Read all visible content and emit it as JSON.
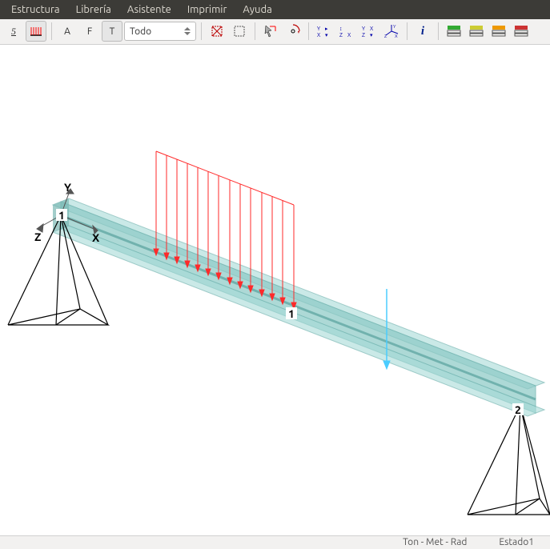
{
  "menu": {
    "items": [
      {
        "label": "Estructura"
      },
      {
        "label": "Librería"
      },
      {
        "label": "Asistente"
      },
      {
        "label": "Imprimir"
      },
      {
        "label": "Ayuda"
      }
    ]
  },
  "toolbar": {
    "node_number": "5",
    "letter_a": "A",
    "letter_f": "F",
    "letter_t": "T",
    "filter_value": "Todo",
    "info_letter": "i"
  },
  "viewport": {
    "axis_x": "X",
    "axis_y": "Y",
    "axis_z": "Z",
    "node1": "1",
    "node2": "2",
    "load_label": "1"
  },
  "status": {
    "units": "Ton - Met - Rad",
    "state": "Estado1"
  },
  "colors": {
    "beam": "#8bc9c5",
    "beam_dark": "#5ea9a5",
    "load": "#ff2a2a",
    "point_load": "#4accff",
    "support": "#000000"
  }
}
